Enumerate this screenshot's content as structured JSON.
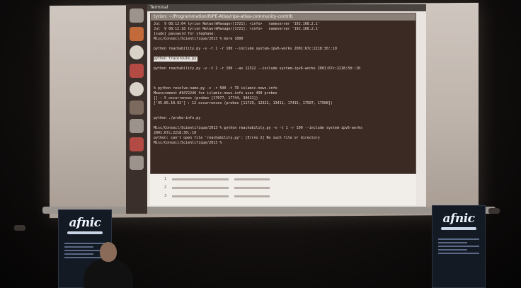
{
  "screen": {
    "top_panel_text": "Terminal",
    "terminal_title": "tyrion: ~/Programmation/RIPE-Atlas/ripe-atlas-community-contrib",
    "terminal_lines": [
      "Jul  9 08:12:04 tyrion NetworkManager[1721]: <info>   nameserver '192.168.2.1'",
      "Jul  9 08:12:18 tyrion NetworkManager[1721]: <info>   nameserver '192.168.2.1'",
      "[sudo] password for stephane:",
      "Misc/Conseil/Scientifique/2013 % more 1000",
      "",
      "python reachability.py -v -t 1 -r 100 --include system-ipv6-works 2001:67c:2218:30::10",
      "",
      "python traceroute.py",
      "",
      "python reachability.py -v -t 1 -r 100 --as 12322 --include system-ipv6-works 2001:67c:2218:30::10",
      "",
      "",
      "",
      "% python resolve-name.py -v -r 500 -t TR islamic-news.info",
      "Measurement #1072246 for islamic-news.info uses 490 probes",
      "[] : 5 occurrences (probes [17077, 17744, 30611])",
      "['95.85.10.92'] : 12 occurrences (probes [11729, 12322, 13411, 17415, 17507, 17908])",
      "",
      "",
      "python ./probe-info.py",
      "",
      "Misc/Conseil/Scientifique/2013 % python reachability.py -v -t 1 -r 100 --include system-ipv6-works",
      "2001:67c:2218:30::10",
      "python: can't open file 'reachability.py': [Errno 2] No such file or directory",
      "Misc/Conseil/Scientifique/2013 %"
    ],
    "highlighted_command": "python traceroute.py",
    "browser_rows": [
      "1",
      "2",
      "3"
    ]
  },
  "banners": {
    "left_logo": "afnic",
    "right_logo": "afnic"
  },
  "colors": {
    "terminal_bg": "#3b2a24",
    "banner_bg": "#141a24",
    "screen": "#c8bfb7"
  }
}
